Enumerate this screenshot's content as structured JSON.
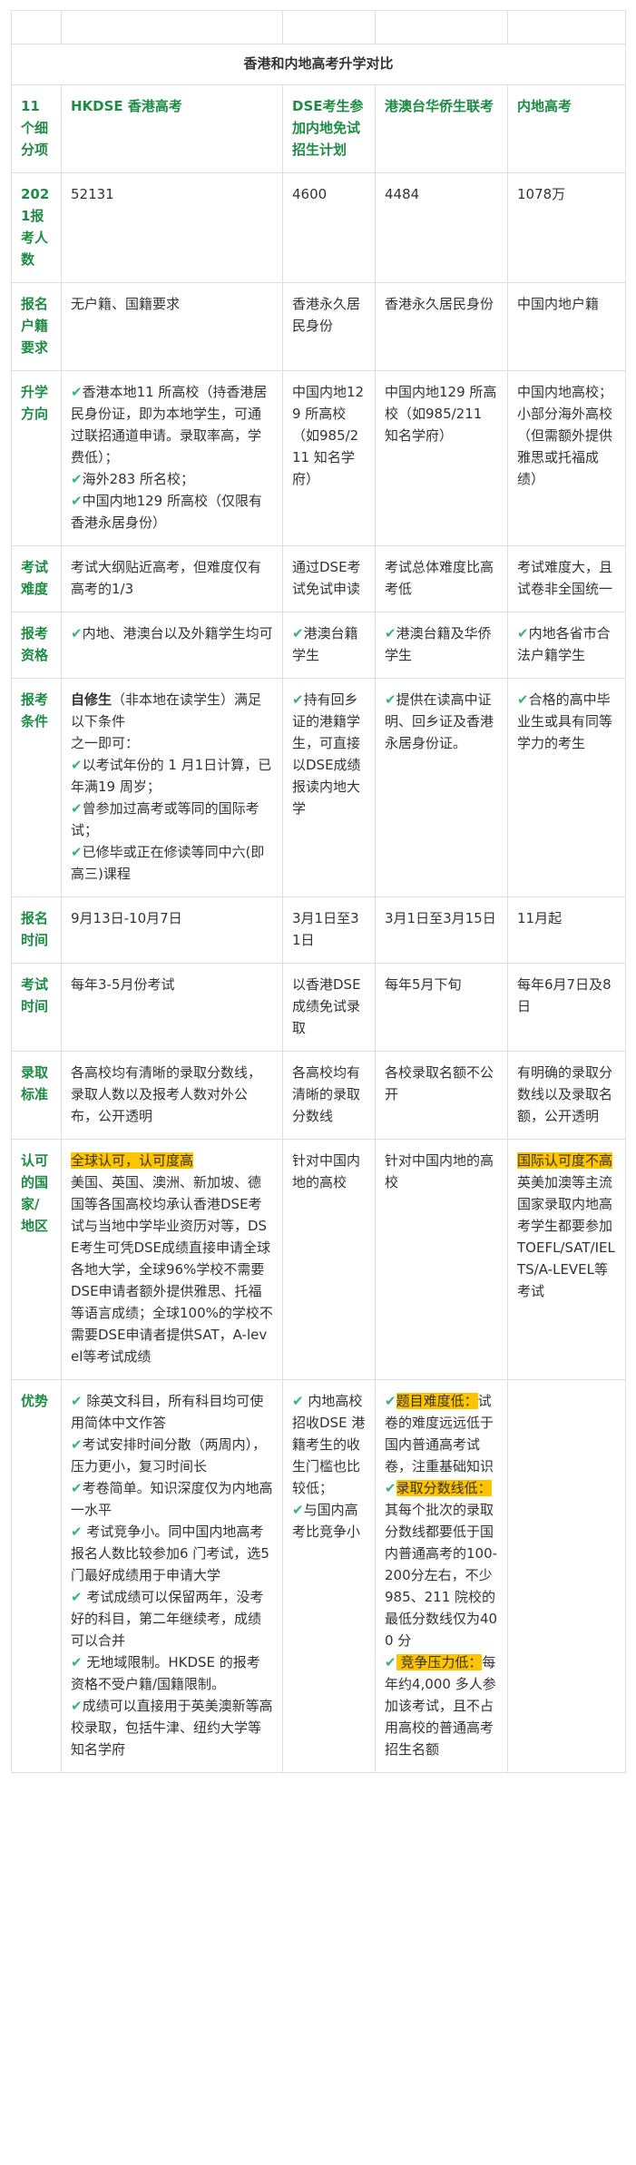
{
  "title": "香港和内地高考升学对比",
  "colors": {
    "header_green": "#1e8c45",
    "check_green": "#3cb371",
    "highlight": "#ffc400"
  },
  "icons": {
    "check": "check-icon"
  },
  "check_glyph": "✔",
  "headers": [
    "11个细分项",
    "HKDSE 香港高考",
    "DSE考生参加内地免试招生计划",
    "港澳台华侨生联考",
    "内地高考"
  ],
  "rows": {
    "count": {
      "label": "2021报考人数",
      "hkdse": "52131",
      "dse": "4600",
      "lk": "4484",
      "gk": "1078万"
    },
    "hukou": {
      "label": "报名户籍要求",
      "hkdse": "无户籍、国籍要求",
      "dse": "香港永久居民身份",
      "lk": "香港永久居民身份",
      "gk": "中国内地户籍"
    },
    "direction": {
      "label": "升学方向",
      "hkdse_1": "香港本地11 所高校（持香港居民身份证，即为本地学生，可通过联招通道申请。录取率高，学费低）；",
      "hkdse_2": "海外283 所名校；",
      "hkdse_3": "中国内地129 所高校（仅限有香港永居身份）",
      "dse": "中国内地129 所高校（如985/211 知名学府）",
      "lk": "中国内地129 所高校（如985/211 知名学府）",
      "gk": "中国内地高校；小部分海外高校（但需额外提供雅思或托福成绩）"
    },
    "difficulty": {
      "label": "考试难度",
      "hkdse": "考试大纲贴近高考，但难度仅有高考的1/3",
      "dse": "通过DSE考试免试申读",
      "lk": "考试总体难度比高考低",
      "gk": "考试难度大，且试卷非全国统一"
    },
    "eligibility": {
      "label": "报考资格",
      "hkdse": "内地、港澳台以及外籍学生均可",
      "dse": "港澳台籍学生",
      "lk": "港澳台籍及华侨学生",
      "gk": "内地各省市合法户籍学生"
    },
    "conditions": {
      "label": "报考条件",
      "hkdse_lead": "自修生",
      "hkdse_lead_rest": "（非本地在读学生）满足以下条件",
      "hkdse_sub": "之一即可：",
      "hkdse_1": "以考试年份的 1 月1日计算，已年满19 周岁；",
      "hkdse_2": "曾参加过高考或等同的国际考试；",
      "hkdse_3": "已修毕或正在修读等同中六(即高三)课程",
      "dse": "持有回乡证的港籍学生，可直接以DSE成绩报读内地大学",
      "lk": "提供在读高中证明、回乡证及香港永居身份证。",
      "gk": "合格的高中毕业生或具有同等学力的考生"
    },
    "reg_time": {
      "label": "报名时间",
      "hkdse": "9月13日-10月7日",
      "dse": "3月1日至31日",
      "lk": "3月1日至3月15日",
      "gk": "11月起"
    },
    "exam_time": {
      "label": "考试时间",
      "hkdse": "每年3-5月份考试",
      "dse": "以香港DSE成绩免试录取",
      "lk": "每年5月下旬",
      "gk": "每年6月7日及8日"
    },
    "admission": {
      "label": "录取标准",
      "hkdse": "各高校均有清晰的录取分数线，录取人数以及报考人数对外公布，公开透明",
      "dse": "各高校均有清晰的录取分数线",
      "lk": "各校录取名额不公开",
      "gk": "有明确的录取分数线以及录取名额，公开透明"
    },
    "recognition": {
      "label": "认可的国家/地区",
      "hkdse_hl": "全球认可，认可度高",
      "hkdse_rest": "美国、英国、澳洲、新加坡、德国等各国高校均承认香港DSE考试与当地中学毕业资历对等，DSE考生可凭DSE成绩直接申请全球各地大学，全球96%学校不需要DSE申请者额外提供雅思、托福等语言成绩；全球100%的学校不需要DSE申请者提供SAT，A-level等考试成绩",
      "dse": "针对中国内地的高校",
      "lk": "针对中国内地的高校",
      "gk_hl": "国际认可度不高",
      "gk_rest": " 英美加澳等主流国家录取内地高考学生都要参加TOEFL/SAT/IELTS/A-LEVEL等考试"
    },
    "advantage": {
      "label": "优势",
      "hkdse_1": " 除英文科目，所有科目均可使用简体中文作答",
      "hkdse_2": "考试安排时间分散（两周内），压力更小，复习时间长",
      "hkdse_3": "考卷简单。知识深度仅为内地高一水平",
      "hkdse_4": " 考试竞争小。同中国内地高考报名人数比较参加6 门考试，选5 门最好成绩用于申请大学",
      "hkdse_5": " 考试成绩可以保留两年，没考好的科目，第二年继续考，成绩可以合并",
      "hkdse_6": " 无地域限制。HKDSE 的报考资格不受户籍/国籍限制。",
      "hkdse_7": "成绩可以直接用于英美澳新等高校录取，包括牛津、纽约大学等知名学府",
      "dse_1": " 内地高校招收DSE 港籍考生的收生门槛也比较低；",
      "dse_2": "与国内高考比竞争小",
      "lk_1_hl": "题目难度低：",
      "lk_1_rest": "试卷的难度远远低于国内普通高考试卷，注重基础知识",
      "lk_2_hl": "录取分数线低：",
      "lk_2_rest": "其每个批次的录取分数线都要低于国内普通高考的100-200分左右，不少985、211 院校的最低分数线仅为400 分",
      "lk_3_hl": " 竞争压力低：",
      "lk_3_rest": "每年约4,000 多人参加该考试，且不占用高校的普通高考招生名额",
      "gk": ""
    }
  }
}
